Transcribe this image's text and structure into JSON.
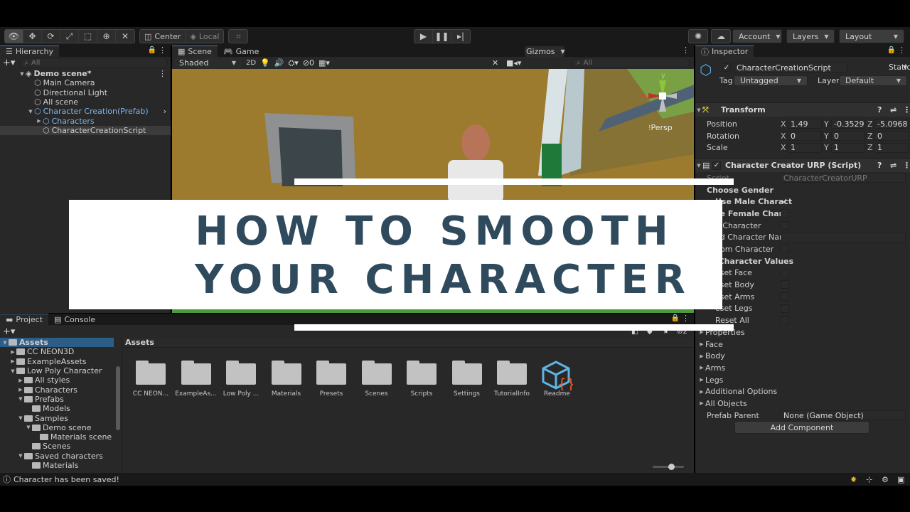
{
  "toolbar": {
    "center_label": "Center",
    "local_label": "Local",
    "account_label": "Account",
    "layers_label": "Layers",
    "layout_label": "Layout"
  },
  "hierarchy": {
    "tab_label": "Hierarchy",
    "search_placeholder": "All",
    "items": [
      {
        "label": "Demo scene*",
        "depth": 0,
        "bold": true
      },
      {
        "label": "Main Camera",
        "depth": 1
      },
      {
        "label": "Directional Light",
        "depth": 1
      },
      {
        "label": "All scene",
        "depth": 1
      },
      {
        "label": "Character Creation(Prefab)",
        "depth": 1,
        "prefab": true
      },
      {
        "label": "Characters",
        "depth": 2,
        "prefab": true
      },
      {
        "label": "CharacterCreationScript",
        "depth": 2,
        "selected": true
      }
    ]
  },
  "scene": {
    "tab_scene": "Scene",
    "tab_game": "Game",
    "shading_mode": "Shaded",
    "mode_2d": "2D",
    "hidden_count": "0",
    "gizmos_label": "Gizmos",
    "search_placeholder": "All",
    "persp_label": "Persp",
    "axis_y": "y",
    "axis_x": "x"
  },
  "overlay": {
    "line1": "HOW TO SMOOTH",
    "line2": "YOUR CHARACTER"
  },
  "project": {
    "tab_project": "Project",
    "tab_console": "Console",
    "tree": [
      {
        "label": "Assets",
        "depth": 0,
        "selected": true
      },
      {
        "label": "CC NEON3D",
        "depth": 1
      },
      {
        "label": "ExampleAssets",
        "depth": 1
      },
      {
        "label": "Low Poly Character",
        "depth": 1
      },
      {
        "label": "All styles",
        "depth": 2
      },
      {
        "label": "Characters",
        "depth": 2
      },
      {
        "label": "Prefabs",
        "depth": 2
      },
      {
        "label": "Models",
        "depth": 3
      },
      {
        "label": "Samples",
        "depth": 2
      },
      {
        "label": "Demo scene",
        "depth": 3
      },
      {
        "label": "Materials scene",
        "depth": 4
      },
      {
        "label": "Scenes",
        "depth": 3
      },
      {
        "label": "Saved characters",
        "depth": 2
      },
      {
        "label": "Materials",
        "depth": 3
      }
    ],
    "breadcrumb": "Assets",
    "assets": [
      "CC NEON...",
      "ExampleAs...",
      "Low Poly ...",
      "Materials",
      "Presets",
      "Scenes",
      "Scripts",
      "Settings",
      "TutorialInfo",
      "Readme"
    ],
    "hidden_count": "2"
  },
  "inspector": {
    "tab_label": "Inspector",
    "object_name": "CharacterCreationScript",
    "static_label": "Static",
    "tag_label": "Tag",
    "tag_value": "Untagged",
    "layer_label": "Layer",
    "layer_value": "Default",
    "transform": {
      "title": "Transform",
      "position_label": "Position",
      "rotation_label": "Rotation",
      "scale_label": "Scale",
      "axis_x": "X",
      "axis_y": "Y",
      "axis_z": "Z",
      "position": {
        "x": "1.49",
        "y": "-0.35295",
        "z": "-5.09684"
      },
      "rotation": {
        "x": "0",
        "y": "0",
        "z": "0"
      },
      "scale": {
        "x": "1",
        "y": "1",
        "z": "1"
      }
    },
    "component": {
      "title": "Character Creator URP (Script)",
      "script_label": "Script",
      "script_value": "CharacterCreatorURP",
      "rows": [
        {
          "label": "Choose Gender",
          "kind": "header"
        },
        {
          "label": "Use Male Charact",
          "kind": "check",
          "checked": true
        },
        {
          "label": "se Female Chara",
          "kind": "check",
          "checked": false
        },
        {
          "label": "e Character",
          "kind": "check",
          "checked": false
        },
        {
          "label": "ed Character Nan",
          "kind": "text"
        },
        {
          "label": "dom Character",
          "kind": "check",
          "checked": false
        },
        {
          "label": "et Character Values",
          "kind": "header"
        },
        {
          "label": "eset Face",
          "kind": "check",
          "checked": false
        },
        {
          "label": "eset Body",
          "kind": "check",
          "checked": false
        },
        {
          "label": "eset Arms",
          "kind": "check",
          "checked": false
        },
        {
          "label": "eset Legs",
          "kind": "check",
          "checked": false
        },
        {
          "label": "Reset All",
          "kind": "check",
          "checked": false
        }
      ],
      "foldouts": [
        "Properties",
        "Face",
        "Body",
        "Arms",
        "Legs",
        "Additional Options",
        "All Objects"
      ],
      "prefab_parent_label": "Prefab Parent",
      "prefab_parent_value": "None (Game Object)"
    },
    "add_component_label": "Add Component"
  },
  "status": {
    "message": "Character has been saved!"
  },
  "colors": {
    "accent_selection": "#2c5d87",
    "prefab_text": "#7fb4ea",
    "wall_ochre": "#9c7a2e",
    "ground_green": "#4f9a3c"
  }
}
